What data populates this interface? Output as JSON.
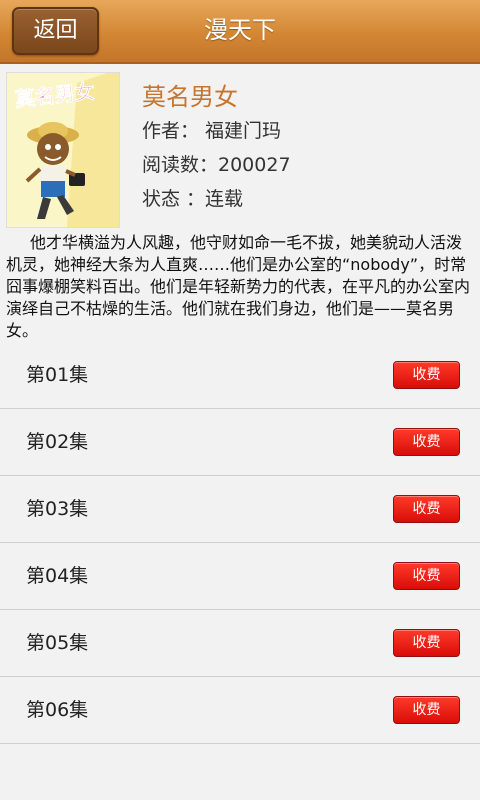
{
  "header": {
    "back_label": "返回",
    "title": "漫天下"
  },
  "book": {
    "cover_text": "莫名男女",
    "title": "莫名男女",
    "author_line": "作者： 福建门玛",
    "reads_line": "阅读数：200027",
    "status_line": "状态  ：连载",
    "description": "他才华横溢为人风趣，他守财如命一毛不拔，她美貌动人活泼机灵，她神经大条为人直爽……他们是办公室的“nobody”，时常囧事爆棚笑料百出。他们是年轻新势力的代表，在平凡的办公室内演绎自己不枯燥的生活。他们就在我们身边，他们是——莫名男女。"
  },
  "episodes": [
    {
      "label": "第01集",
      "fee_label": "收费"
    },
    {
      "label": "第02集",
      "fee_label": "收费"
    },
    {
      "label": "第03集",
      "fee_label": "收费"
    },
    {
      "label": "第04集",
      "fee_label": "收费"
    },
    {
      "label": "第05集",
      "fee_label": "收费"
    },
    {
      "label": "第06集",
      "fee_label": "收费"
    }
  ],
  "colors": {
    "header_bar": "#d38734",
    "back_button": "#8a5226",
    "title_accent": "#c8742b",
    "fee_button": "#e8160f"
  }
}
